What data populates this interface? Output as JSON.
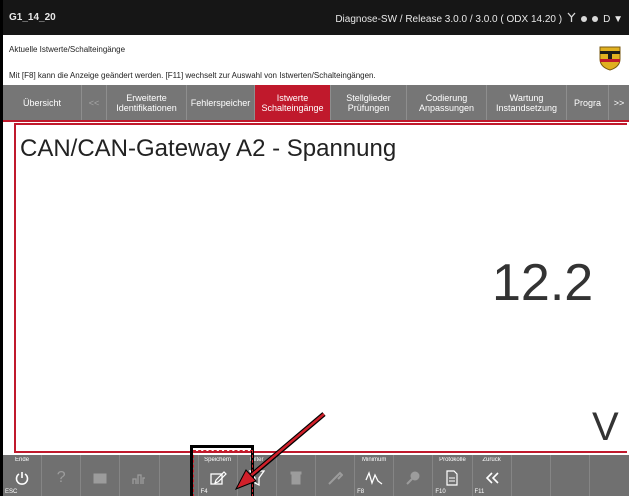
{
  "titlebar": {
    "id": "G1_14_20",
    "release": "Diagnose-SW / Release 3.0.0 / 3.0.0  ( ODX  14.20 )",
    "menu": "D ▼"
  },
  "info": {
    "line1": "Aktuelle Istwerte/Schalteingänge",
    "line2": "Mit [F8] kann die Anzeige geändert werden. [F11] wechselt zur Auswahl von Istwerten/Schalteingängen."
  },
  "tabs": [
    {
      "label": "Übersicht"
    },
    {
      "label": "<<"
    },
    {
      "label": "Erweiterte Identifikationen"
    },
    {
      "label": "Fehlerspeicher"
    },
    {
      "label": "Istwerte Schalteingänge"
    },
    {
      "label": "Stellglieder Prüfungen"
    },
    {
      "label": "Codierung Anpassungen"
    },
    {
      "label": "Wartung Instandsetzung"
    },
    {
      "label": "Progra"
    },
    {
      "label": ">>"
    }
  ],
  "main": {
    "heading": "CAN/CAN-Gateway A2 - Spannung",
    "value": "12.2",
    "unit": "V"
  },
  "fkeys": [
    {
      "label": "Ende",
      "key": "ESC",
      "icon": "power-icon"
    },
    {
      "label": "",
      "key": "",
      "icon": "help-icon"
    },
    {
      "label": "",
      "key": "",
      "icon": "box-icon"
    },
    {
      "label": "",
      "key": "",
      "icon": "bar-chart-icon"
    },
    {
      "label": "",
      "key": "",
      "icon": "blank"
    },
    {
      "label": "Speichern",
      "key": "F4",
      "icon": "save-edit-icon"
    },
    {
      "label": "Filter",
      "key": "",
      "icon": "filter-icon"
    },
    {
      "label": "",
      "key": "",
      "icon": "trash-icon"
    },
    {
      "label": "",
      "key": "",
      "icon": "tool-icon"
    },
    {
      "label": "Minimum",
      "key": "F8",
      "icon": "waveform-icon"
    },
    {
      "label": "",
      "key": "",
      "icon": "diagnostic-icon"
    },
    {
      "label": "Protokolle",
      "key": "F10",
      "icon": "document-icon"
    },
    {
      "label": "Zurück",
      "key": "F11",
      "icon": "back-icon"
    },
    {
      "label": "",
      "key": "",
      "icon": "blank"
    },
    {
      "label": "",
      "key": "",
      "icon": "blank"
    },
    {
      "label": "",
      "key": "",
      "icon": "blank"
    }
  ],
  "colors": {
    "accent": "#c0192c",
    "titlebar": "#161616",
    "tabbar": "#767676",
    "fkeybar": "#707070",
    "arrow": "#d0202a"
  }
}
